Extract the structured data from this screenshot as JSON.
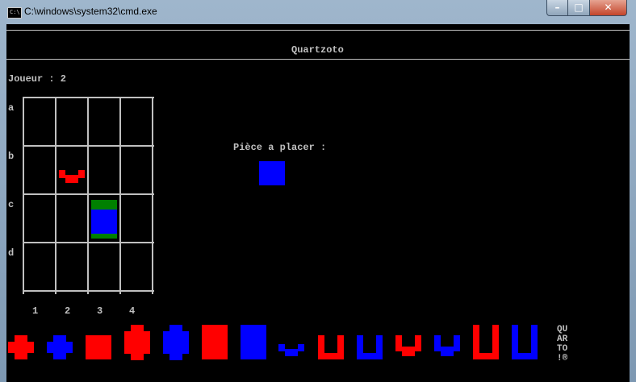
{
  "window": {
    "title": "C:\\windows\\system32\\cmd.exe",
    "app_icon_text": "C:\\",
    "controls": {
      "minimize": "–",
      "maximize": "□",
      "close": "✕"
    }
  },
  "game": {
    "title": "Quartzoto",
    "player_label": "Joueur : 2",
    "piece_to_place_label": "Pièce a placer :",
    "row_labels": [
      "a",
      "b",
      "c",
      "d"
    ],
    "col_labels": [
      "1",
      "2",
      "3",
      "4"
    ],
    "logo_lines": [
      "QU",
      "AR",
      "TO",
      "!®"
    ]
  },
  "board": {
    "placed": [
      {
        "row": "b",
        "col": "2",
        "shape": "cup-short",
        "color": "red"
      },
      {
        "row": "c",
        "col": "3",
        "shape": "square-tall-bordered",
        "color": "blue",
        "border": "green"
      }
    ]
  },
  "next_piece": {
    "shape": "square-short",
    "color": "blue"
  },
  "reserve_pieces": [
    {
      "shape": "cross-short",
      "color": "red"
    },
    {
      "shape": "cross-short",
      "color": "blue"
    },
    {
      "shape": "square-short",
      "color": "red"
    },
    {
      "shape": "cross-tall",
      "color": "red"
    },
    {
      "shape": "cross-tall",
      "color": "blue"
    },
    {
      "shape": "square-tall",
      "color": "red"
    },
    {
      "shape": "square-tall",
      "color": "blue"
    },
    {
      "shape": "cup-short",
      "color": "blue"
    },
    {
      "shape": "u-short",
      "color": "red"
    },
    {
      "shape": "u-short",
      "color": "blue"
    },
    {
      "shape": "cup-medium",
      "color": "red"
    },
    {
      "shape": "cup-medium",
      "color": "blue"
    },
    {
      "shape": "u-tall",
      "color": "red"
    },
    {
      "shape": "u-tall",
      "color": "blue"
    }
  ],
  "colors": {
    "red": "#ff0000",
    "blue": "#0000ff",
    "green": "#008000",
    "grid": "#c0c0c0",
    "background": "#000000"
  }
}
